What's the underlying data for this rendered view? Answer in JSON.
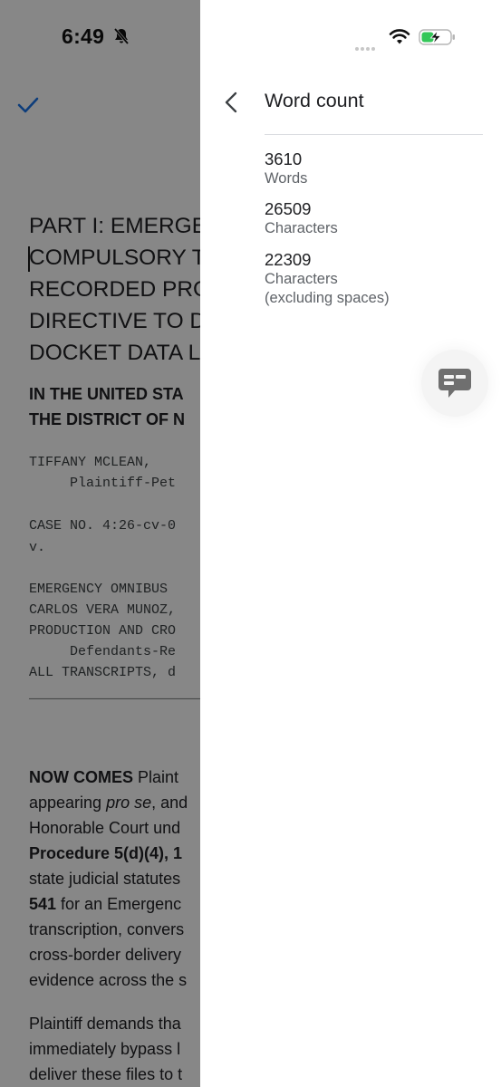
{
  "status_bar": {
    "time": "6:49",
    "icons": [
      "bell-slash-icon",
      "cellular-signal-icon",
      "wifi-icon",
      "battery-charging-icon"
    ],
    "battery_color": "#34c759"
  },
  "document": {
    "heading_lines": [
      "PART I: EMERGE",
      "COMPULSORY T",
      "RECORDED PRO",
      "DIRECTIVE TO D",
      "DOCKET DATA L"
    ],
    "court_lines": [
      "IN THE UNITED STA",
      "THE DISTRICT OF N"
    ],
    "caption": {
      "plaintiff": "TIFFANY MCLEAN,",
      "plaintiff_role": "     Plaintiff-Pet",
      "case_no": "CASE NO. 4:26-cv-0",
      "versus": "v.",
      "defendant_1": "EMERGENCY OMNIBUS ",
      "defendant_2": "CARLOS VERA MUNOZ,",
      "defendant_3": "PRODUCTION AND CRO",
      "defendant_role": "     Defendants-Re",
      "defendant_4": "ALL TRANSCRIPTS, d",
      "rule": "_______________________"
    },
    "paragraph_1": {
      "line_1_bold": "NOW COMES",
      "line_1_rest": " Plaint",
      "line_2_pre": "appearing ",
      "line_2_italic": "pro se",
      "line_2_post": ", and",
      "line_3": "Honorable Court und",
      "line_4_bold": "Procedure 5(d)(4), 1",
      "line_5": "state judicial statutes",
      "line_6_bold": "541",
      "line_6_rest": " for an Emergenc",
      "line_7": "transcription, convers",
      "line_8": "cross-border delivery",
      "line_9": "evidence across the s"
    },
    "paragraph_2": {
      "line_1": "Plaintiff demands tha",
      "line_2": "immediately bypass l",
      "line_3": "deliver these files to t"
    }
  },
  "panel": {
    "title": "Word count",
    "stats": [
      {
        "value": "3610",
        "label": "Words"
      },
      {
        "value": "26509",
        "label": "Characters"
      },
      {
        "value": "22309",
        "label": "Characters",
        "label_2": "(excluding spaces)"
      }
    ],
    "accent_color": "#1a73e8"
  }
}
